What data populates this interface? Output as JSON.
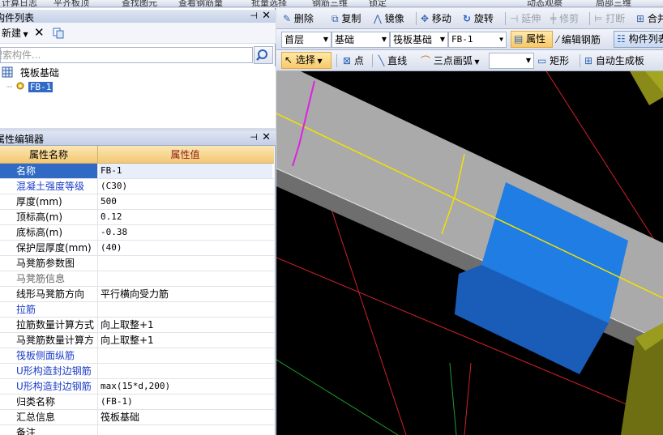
{
  "top_strip": [
    "计算日志",
    "平齐板顶",
    "查找图元",
    "查看钢筋量",
    "批量选择",
    "钢筋三维",
    "锁定",
    "动态观察",
    "局部三维"
  ],
  "component_list": {
    "title": "构件列表",
    "new_label": "新建",
    "search_placeholder": "搜索构件...",
    "tree_root": "筏板基础",
    "tree_child": "FB-1"
  },
  "property_editor": {
    "title": "属性编辑器",
    "col_name": "属性名称",
    "col_value": "属性值",
    "rows": [
      {
        "name": "名称",
        "value": "FB-1"
      },
      {
        "name": "混凝土强度等级",
        "value": "(C30)"
      },
      {
        "name": "厚度(mm)",
        "value": "500"
      },
      {
        "name": "顶标高(m)",
        "value": "0.12"
      },
      {
        "name": "底标高(m)",
        "value": "-0.38"
      },
      {
        "name": "保护层厚度(mm)",
        "value": "(40)"
      },
      {
        "name": "马凳筋参数图",
        "value": ""
      },
      {
        "name": "马凳筋信息",
        "value": ""
      },
      {
        "name": "线形马凳筋方向",
        "value": "平行横向受力筋"
      },
      {
        "name": "拉筋",
        "value": ""
      },
      {
        "name": "拉筋数量计算方式",
        "value": "向上取整+1"
      },
      {
        "name": "马凳筋数量计算方",
        "value": "向上取整+1"
      },
      {
        "name": "筏板侧面纵筋",
        "value": ""
      },
      {
        "name": "U形构造封边钢筋",
        "value": ""
      },
      {
        "name": "U形构造封边钢筋",
        "value": "max(15*d,200)"
      },
      {
        "name": "归类名称",
        "value": "(FB-1)"
      },
      {
        "name": "汇总信息",
        "value": "筏板基础"
      },
      {
        "name": "备注",
        "value": ""
      }
    ]
  },
  "toolbar1": {
    "delete": "删除",
    "copy": "复制",
    "mirror": "镜像",
    "move": "移动",
    "rotate": "旋转",
    "extend": "延伸",
    "trim": "修剪",
    "break": "打断",
    "merge": "合并"
  },
  "toolbar2": {
    "floor": "首层",
    "category": "基础",
    "type": "筏板基础",
    "component": "FB-1",
    "properties": "属性",
    "edit_rebar": "编辑钢筋",
    "component_list": "构件列表"
  },
  "toolbar3": {
    "select": "选择",
    "point": "点",
    "line": "直线",
    "arc": "三点画弧",
    "rect": "矩形",
    "auto": "自动生成板"
  },
  "colors": {
    "selection_blue": "#316ac5",
    "header_gold": "#f4c874",
    "viewport_bg": "#000000",
    "slab_gray": "#a9a9a9",
    "selected_face": "#1e7be0"
  }
}
